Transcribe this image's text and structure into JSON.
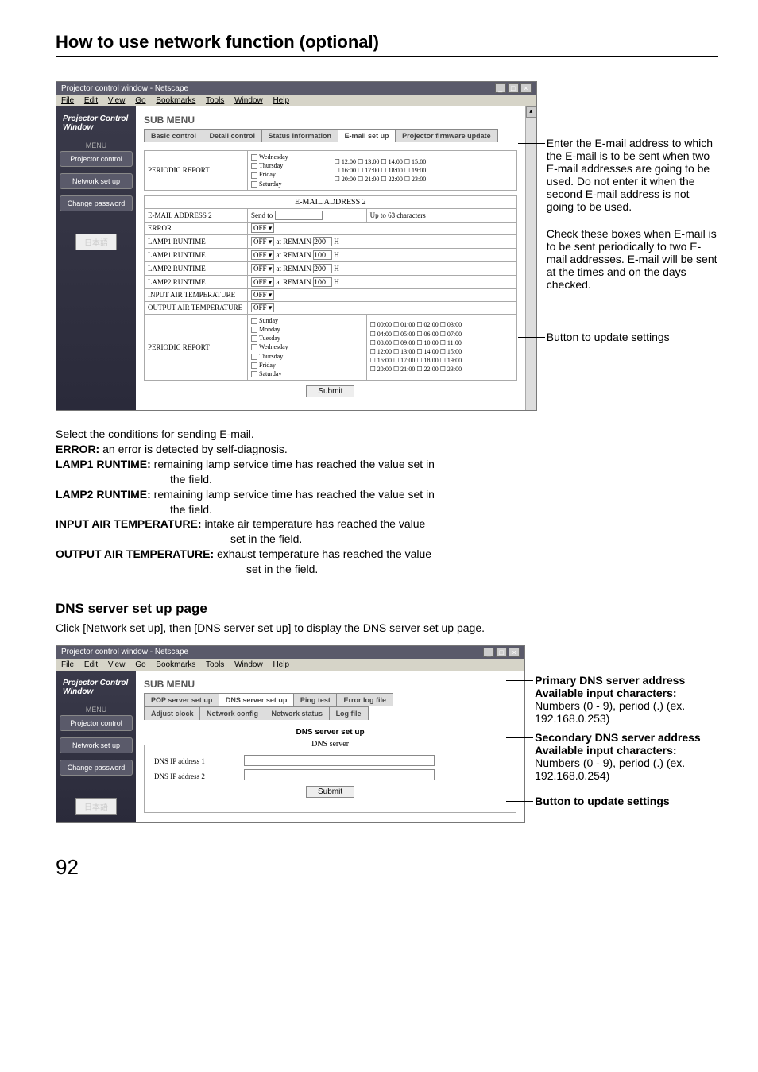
{
  "page": {
    "title": "How to use network function (optional)",
    "number": "92"
  },
  "browser": {
    "window_title": "Projector control window - Netscape",
    "menu_items": [
      "File",
      "Edit",
      "View",
      "Go",
      "Bookmarks",
      "Tools",
      "Window",
      "Help"
    ]
  },
  "sidebar": {
    "pcw": "Projector Control Window",
    "menu_label": "MENU",
    "items": [
      "Projector control",
      "Network set up",
      "Change password"
    ],
    "jp_button": "日本語"
  },
  "submenu": {
    "label": "SUB MENU",
    "tabs1": [
      "Basic control",
      "Detail control",
      "Status information",
      "E-mail set up",
      "Projector firmware update"
    ],
    "tabs2": [
      "POP server set up",
      "DNS server set up",
      "Ping test",
      "Error log file",
      "Adjust clock",
      "Network config",
      "Network status",
      "Log file"
    ]
  },
  "email": {
    "periodic_report_label": "PERIODIC REPORT",
    "days1": [
      "Wednesday",
      "Thursday",
      "Friday",
      "Saturday"
    ],
    "times_row1": [
      "12:00 ☐ 13:00 ☐ 14:00 ☐ 15:00",
      "16:00 ☐ 17:00 ☐ 18:00 ☐ 19:00",
      "20:00 ☐ 21:00 ☐ 22:00 ☐ 23:00"
    ],
    "addr2_header": "E-MAIL ADDRESS 2",
    "rows": [
      {
        "label": "E-MAIL ADDRESS 2",
        "ctrl": "Send to",
        "note": "Up to 63 characters"
      },
      {
        "label": "ERROR",
        "ctrl": "OFF"
      },
      {
        "label": "LAMP1 RUNTIME",
        "ctrl": "OFF at REMAIN 200 H"
      },
      {
        "label": "LAMP1 RUNTIME",
        "ctrl": "OFF at REMAIN 100 H"
      },
      {
        "label": "LAMP2 RUNTIME",
        "ctrl": "OFF at REMAIN 200 H"
      },
      {
        "label": "LAMP2 RUNTIME",
        "ctrl": "OFF at REMAIN 100 H"
      },
      {
        "label": "INPUT AIR TEMPERATURE",
        "ctrl": "OFF"
      },
      {
        "label": "OUTPUT AIR TEMPERATURE",
        "ctrl": "OFF"
      }
    ],
    "days2": [
      "Sunday",
      "Monday",
      "Tuesday",
      "Wednesday",
      "Thursday",
      "Friday",
      "Saturday"
    ],
    "times2": [
      "00:00 ☐ 01:00 ☐ 02:00 ☐ 03:00",
      "04:00 ☐ 05:00 ☐ 06:00 ☐ 07:00",
      "08:00 ☐ 09:00 ☐ 10:00 ☐ 11:00",
      "12:00 ☐ 13:00 ☐ 14:00 ☐ 15:00",
      "16:00 ☐ 17:00 ☐ 18:00 ☐ 19:00",
      "20:00 ☐ 21:00 ☐ 22:00 ☐ 23:00"
    ],
    "submit": "Submit"
  },
  "annotations1": {
    "a1": "Enter the E-mail address to which the E-mail is to be sent when two E-mail addresses are going to be used. Do not enter it when the second E-mail address is not going to be used.",
    "a2": "Check these boxes when E-mail is to be sent periodically to two E-mail addresses. E-mail will be sent at the times and on the days checked.",
    "a3": "Button to update settings"
  },
  "conditions": {
    "intro": "Select the conditions for sending E-mail.",
    "error_lbl": "ERROR:",
    "error_txt": " an error is detected by self-diagnosis.",
    "l1_lbl": "LAMP1 RUNTIME:",
    "l1_txt": " remaining lamp service time has reached the value set in",
    "l1_txt2": "the field.",
    "l2_lbl": "LAMP2 RUNTIME:",
    "l2_txt": " remaining lamp service time has reached the value set in",
    "l2_txt2": "the field.",
    "in_lbl": "INPUT AIR TEMPERATURE:",
    "in_txt": " intake air temperature has reached the value",
    "in_txt2": "set in the field.",
    "out_lbl": "OUTPUT AIR TEMPERATURE:",
    "out_txt": " exhaust temperature has reached the value",
    "out_txt2": "set in the field."
  },
  "dns_section": {
    "heading": "DNS server set up page",
    "intro": "Click [Network set up], then [DNS server set up] to display the DNS server set up page.",
    "page_title": "DNS server set up",
    "fieldset_legend": "DNS server",
    "addr1_label": "DNS IP address 1",
    "addr2_label": "DNS IP address 2",
    "submit": "Submit"
  },
  "annotations2": {
    "a1_h": "Primary DNS server address",
    "a1_b": "Available input characters:",
    "a1_t": "Numbers (0 - 9), period (.) (ex. 192.168.0.253)",
    "a2_h": "Secondary DNS server address",
    "a2_b": "Available input characters:",
    "a2_t": "Numbers (0 - 9), period (.) (ex. 192.168.0.254)",
    "a3_h": "Button to update settings"
  }
}
